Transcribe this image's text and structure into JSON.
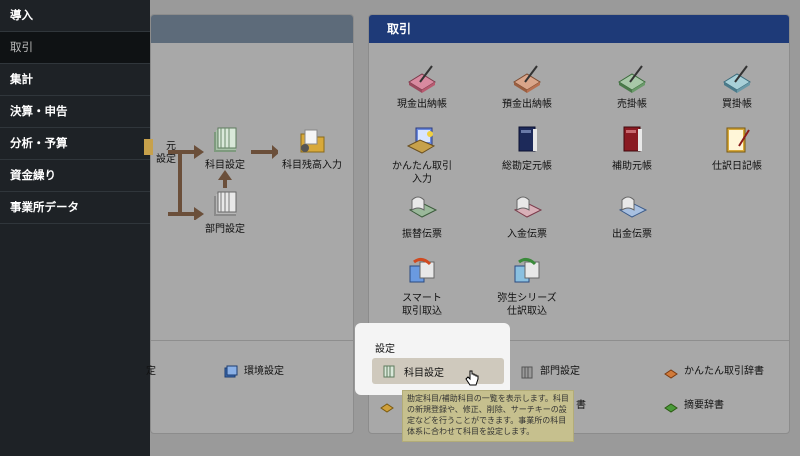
{
  "sidebar": {
    "items": [
      {
        "label": "導入",
        "active": false
      },
      {
        "label": "取引",
        "active": true
      },
      {
        "label": "集計",
        "active": false
      },
      {
        "label": "決算・申告",
        "active": false
      },
      {
        "label": "分析・予算",
        "active": false
      },
      {
        "label": "資金繰り",
        "active": false
      },
      {
        "label": "事業所データ",
        "active": false
      }
    ]
  },
  "left_panel": {
    "flow": {
      "partial_label_1": "元",
      "partial_label_2": "設定",
      "kamoku": "科目設定",
      "bumon": "部門設定",
      "zandaka": "科目残高入力"
    },
    "links": {
      "partial_settings": "定",
      "env_settings": "環境設定"
    }
  },
  "right_panel": {
    "title": "取引",
    "items": {
      "genkin": "現金出納帳",
      "yokin": "預金出納帳",
      "urikake": "売掛帳",
      "kaikake": "買掛帳",
      "kantan_1": "かんたん取引",
      "kantan_2": "入力",
      "souki": "総勘定元帳",
      "hojo": "補助元帳",
      "shiwake_nikki": "仕訳日記帳",
      "furikae": "振替伝票",
      "nyukin": "入金伝票",
      "shukkin": "出金伝票",
      "smart_1": "スマート",
      "smart_2": "取引取込",
      "yayoi_1": "弥生シリーズ",
      "yayoi_2": "仕訳取込"
    },
    "settings": {
      "section_label": "設定",
      "kamoku": "科目設定",
      "bumon": "部門設定",
      "kantan_jisho": "かんたん取引辞書",
      "partial": "書",
      "tekiyo": "摘要辞書"
    }
  },
  "tooltip": {
    "text": "勘定科目/補助科目の一覧を表示します。科目の新規登録や、修正、削除、サーチキーの設定などを行うことができます。事業所の科目体系に合わせて科目を設定します。"
  },
  "icons": {
    "ledger": "ledger-pen-icon",
    "book_blue": "book-icon",
    "book_red": "book-icon",
    "journal": "journal-icon",
    "slip": "slip-icon",
    "import": "import-icon",
    "accounts": "accounts-icon",
    "folder": "folder-icon",
    "gear": "gear-icon",
    "env": "window-icon",
    "dict": "dictionary-icon"
  }
}
